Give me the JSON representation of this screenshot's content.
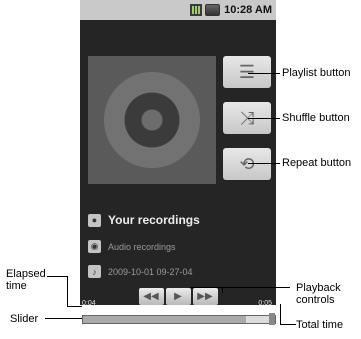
{
  "status": {
    "time": "10:28 AM"
  },
  "album": {
    "title": "Your recordings",
    "subtitle": "Audio recordings",
    "timestamp": "2009-10-01 09-27-04"
  },
  "playback": {
    "elapsed": "0:04",
    "total": "0:05",
    "progress": 0.85
  },
  "icons": {
    "prev": "rewind-icon",
    "play": "play-icon",
    "next": "fast-forward-icon",
    "playlist": "playlist-icon",
    "shuffle": "shuffle-icon",
    "repeat": "repeat-icon"
  },
  "callouts": {
    "playlist": "Playlist button",
    "shuffle": "Shuffle button",
    "repeat": "Repeat button",
    "playback": "Playback\ncontrols",
    "elapsed": "Elapsed\ntime",
    "slider": "Slider",
    "total": "Total time"
  }
}
